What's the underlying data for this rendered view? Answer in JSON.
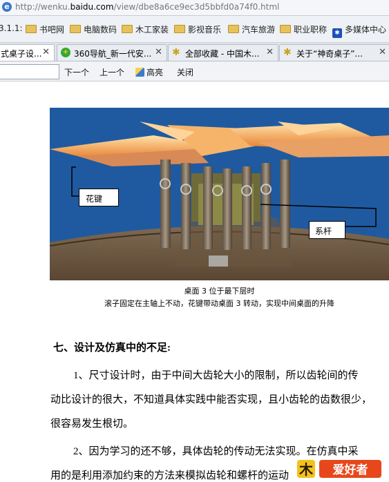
{
  "address_bar": {
    "url_prefix": "http://wenku.",
    "url_domain": "baidu.com",
    "url_suffix": "/view/dbe8a6ce9ec3d5bbfd0a74f0.html"
  },
  "favorites": [
    "3.1.1:",
    "书吧网",
    "电脑数码",
    "木工家装",
    "影视音乐",
    "汽车旅游",
    "职业职称",
    "多媒体中心"
  ],
  "tabs": [
    {
      "title": "式桌子设...",
      "active": true
    },
    {
      "title": "360导航_新一代安...",
      "icon": "360-icon"
    },
    {
      "title": "全部收藏 - 中国木...",
      "icon": "star-icon"
    },
    {
      "title": "关于“神奇桌子”...",
      "icon": "star-icon"
    }
  ],
  "find_bar": {
    "search_value": "",
    "next": "下一个",
    "prev": "上一个",
    "highlight": "高亮",
    "close": "关闭"
  },
  "figure": {
    "label_left": "花键",
    "label_right": "系杆"
  },
  "captions": [
    "桌面 3 位于最下层时",
    "滚子固定在主轴上不动，花键带动桌面 3 转动，实现中间桌面的升降"
  ],
  "section_heading": "七、设计及仿真中的不足:",
  "paragraphs": [
    "1、尺寸设计时，由于中间大齿轮大小的限制，所以齿轮间的传",
    "动比设计的很大，不知道具体实践中能否实现，且小齿轮的齿数很少，",
    "很容易发生根切。",
    "2、因为学习的还不够，具体齿轮的传动无法实现。在仿真中采",
    "用的是利用添加约束的方法来模拟齿轮和螺杆的运动"
  ],
  "watermark": {
    "text": "爱好者"
  },
  "colors": {
    "figure_bg": "#1f5aa0",
    "wood": "#8a6e4a",
    "blade": "#f5a651"
  }
}
